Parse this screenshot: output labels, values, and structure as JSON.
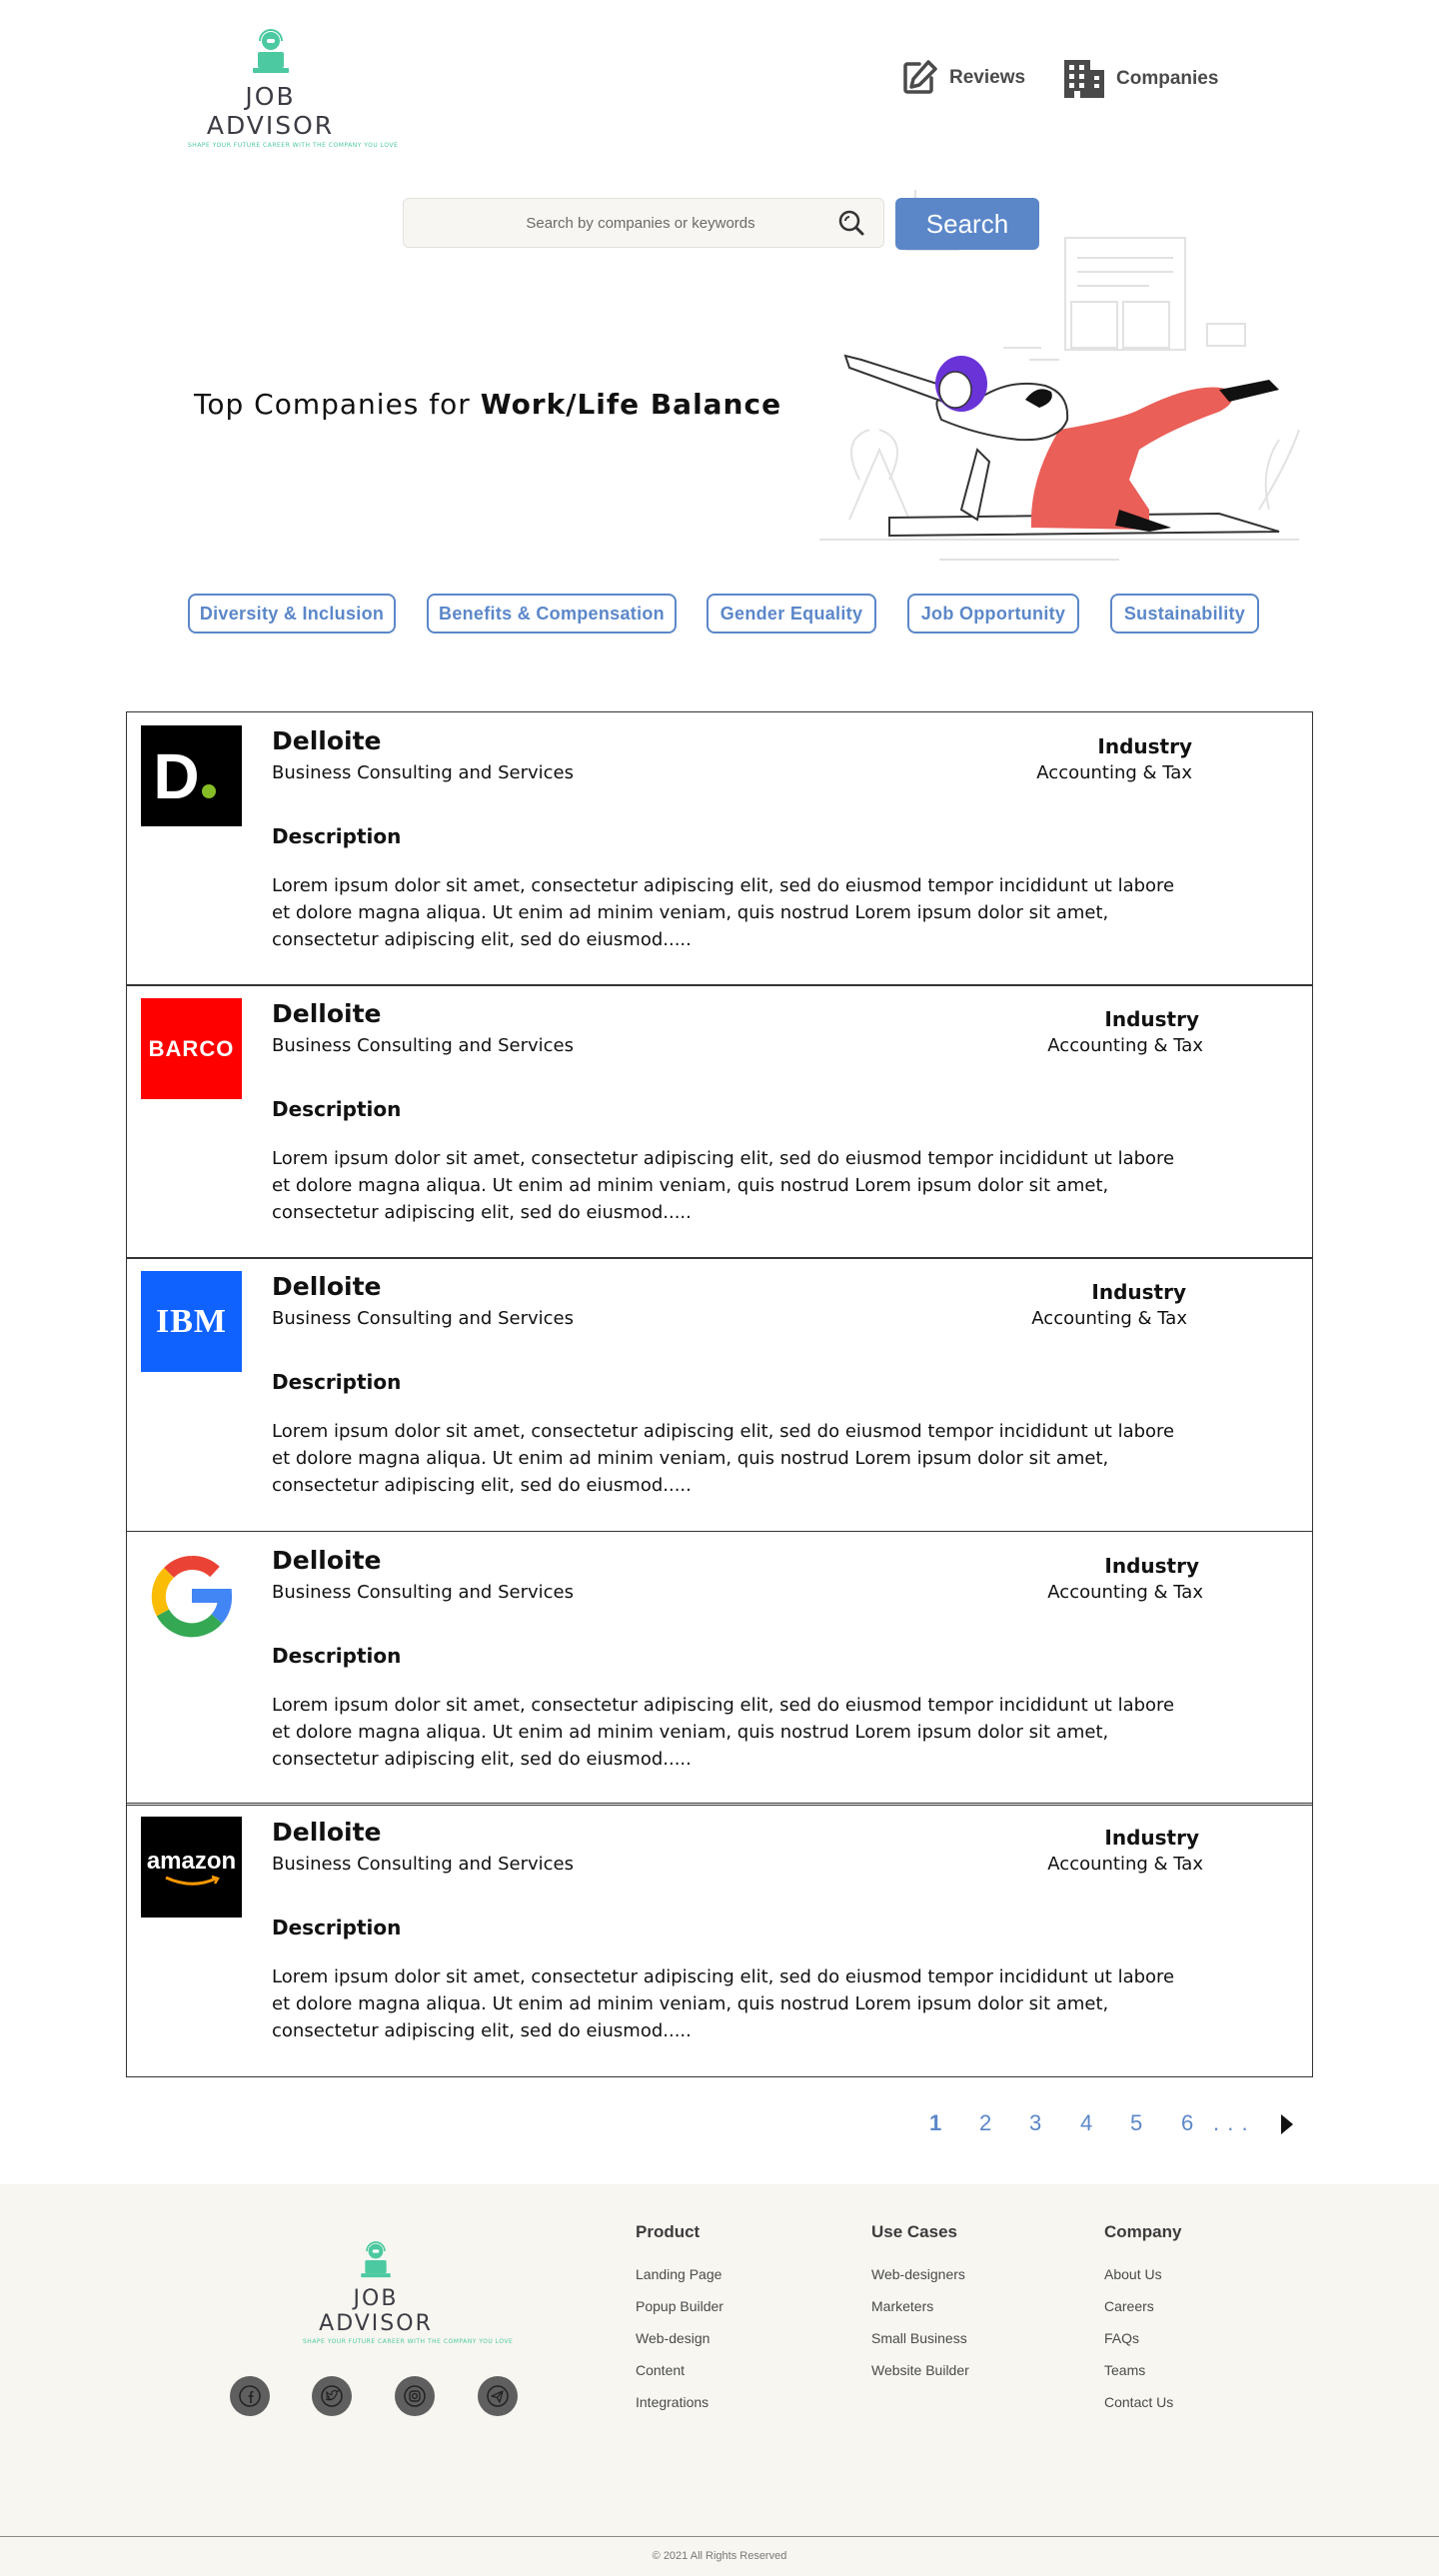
{
  "brand": {
    "name": "JOB ADVISOR",
    "tagline": "SHAPE YOUR FUTURE CAREER WITH THE COMPANY YOU LOVE",
    "accent_color": "#4cc9a0"
  },
  "nav": {
    "items": [
      {
        "label": "Reviews",
        "icon": "edit-icon"
      },
      {
        "label": "Companies",
        "icon": "building-icon"
      }
    ]
  },
  "search": {
    "placeholder": "Search by companies or keywords",
    "button_label": "Search",
    "button_color": "#5b87c9"
  },
  "hero": {
    "title_prefix": "Top Companies for ",
    "title_bold": "Work/Life Balance",
    "illustration": "woman-doing-yoga-with-cat-illustration"
  },
  "categories": [
    "Diversity & Inclusion",
    "Benefits & Compensation",
    "Gender Equality",
    "Job Opportunity",
    "Sustainability"
  ],
  "companies": [
    {
      "logo": "deloitte-logo",
      "logo_text": "D",
      "name": "Delloite",
      "subtitle": "Business Consulting and Services",
      "industry_label": "Industry",
      "industry": "Accounting & Tax",
      "description_title": "Description",
      "description": "Lorem ipsum dolor sit amet, consectetur adipiscing elit, sed do eiusmod tempor incididunt ut labore et dolore magna aliqua. Ut enim ad minim veniam, quis nostrud Lorem ipsum dolor sit amet, consectetur adipiscing elit, sed do eiusmod....."
    },
    {
      "logo": "barco-logo",
      "logo_text": "BARCO",
      "name": "Delloite",
      "subtitle": "Business Consulting and Services",
      "industry_label": "Industry",
      "industry": "Accounting & Tax",
      "description_title": "Description",
      "description": "Lorem ipsum dolor sit amet, consectetur adipiscing elit, sed do eiusmod tempor incididunt ut labore et dolore magna aliqua. Ut enim ad minim veniam, quis nostrud Lorem ipsum dolor sit amet, consectetur adipiscing elit, sed do eiusmod....."
    },
    {
      "logo": "ibm-logo",
      "logo_text": "IBM",
      "name": "Delloite",
      "subtitle": "Business Consulting and Services",
      "industry_label": "Industry",
      "industry": "Accounting & Tax",
      "description_title": "Description",
      "description": "Lorem ipsum dolor sit amet, consectetur adipiscing elit, sed do eiusmod tempor incididunt ut labore et dolore magna aliqua. Ut enim ad minim veniam, quis nostrud Lorem ipsum dolor sit amet, consectetur adipiscing elit, sed do eiusmod....."
    },
    {
      "logo": "google-logo",
      "logo_text": "G",
      "name": "Delloite",
      "subtitle": "Business Consulting and Services",
      "industry_label": "Industry",
      "industry": "Accounting & Tax",
      "description_title": "Description",
      "description": "Lorem ipsum dolor sit amet, consectetur adipiscing elit, sed do eiusmod tempor incididunt ut labore et dolore magna aliqua. Ut enim ad minim veniam, quis nostrud Lorem ipsum dolor sit amet, consectetur adipiscing elit, sed do eiusmod....."
    },
    {
      "logo": "amazon-logo",
      "logo_text": "amazon",
      "name": "Delloite",
      "subtitle": "Business Consulting and Services",
      "industry_label": "Industry",
      "industry": "Accounting & Tax",
      "description_title": "Description",
      "description": "Lorem ipsum dolor sit amet, consectetur adipiscing elit, sed do eiusmod tempor incididunt ut labore et dolore magna aliqua. Ut enim ad minim veniam, quis nostrud Lorem ipsum dolor sit amet, consectetur adipiscing elit, sed do eiusmod....."
    }
  ],
  "pagination": {
    "pages": [
      "1",
      "2",
      "3",
      "4",
      "5",
      "6"
    ],
    "current": "1",
    "ellipsis": ". . .",
    "next_icon": "play-triangle-icon"
  },
  "footer": {
    "social": [
      "facebook-icon",
      "twitter-icon",
      "instagram-icon",
      "telegram-icon"
    ],
    "columns": [
      {
        "title": "Product",
        "links": [
          "Landing Page",
          "Popup Builder",
          "Web-design",
          "Content",
          "Integrations"
        ]
      },
      {
        "title": "Use Cases",
        "links": [
          "Web-designers",
          "Marketers",
          "Small Business",
          "Website Builder"
        ]
      },
      {
        "title": "Company",
        "links": [
          "About Us",
          "Careers",
          "FAQs",
          "Teams",
          "Contact Us"
        ]
      }
    ],
    "copyright": "© 2021 All Rights Reserved"
  }
}
